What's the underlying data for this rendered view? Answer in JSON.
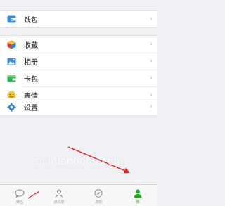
{
  "menu": {
    "wallet": {
      "label": "钱包",
      "icon": "wallet-icon"
    },
    "favorites": {
      "label": "收藏",
      "icon": "favorites-cube-icon"
    },
    "album": {
      "label": "相册",
      "icon": "album-photo-icon"
    },
    "cards": {
      "label": "卡包",
      "icon": "card-wallet-icon"
    },
    "stickers": {
      "label": "表情",
      "icon": "smiley-icon"
    },
    "settings": {
      "label": "设置",
      "icon": "gear-icon"
    }
  },
  "tabbar": {
    "tabs": [
      {
        "label": "微信",
        "icon": "chat-bubble-icon"
      },
      {
        "label": "通讯录",
        "icon": "contacts-icon"
      },
      {
        "label": "发现",
        "icon": "compass-icon"
      },
      {
        "label": "我",
        "icon": "person-icon",
        "active": true
      }
    ]
  },
  "watermark": {
    "text": "sichuanhong.com"
  },
  "colors": {
    "accent_green": "#1aad19",
    "arrow_red": "#e8231f",
    "background": "#efeff4"
  }
}
